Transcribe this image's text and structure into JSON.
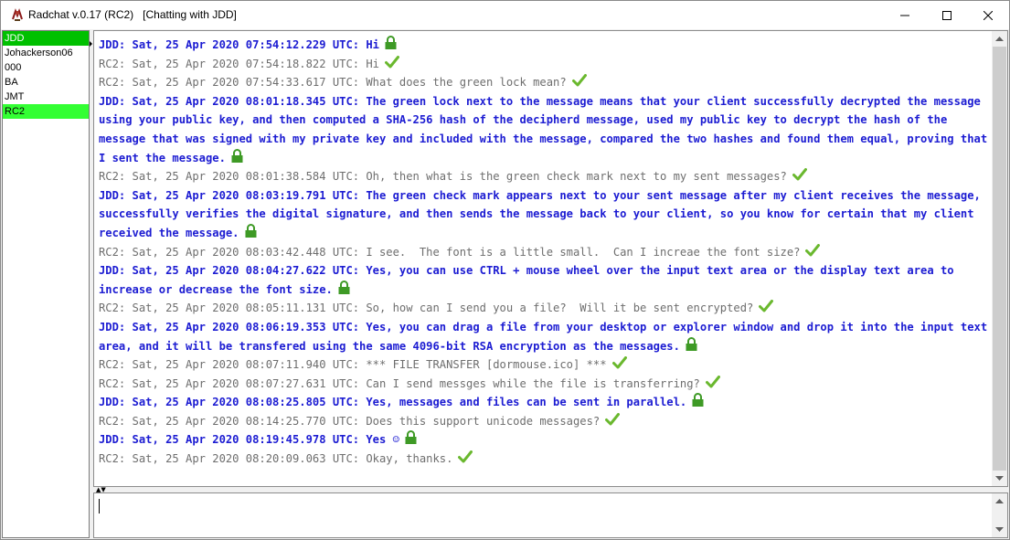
{
  "window": {
    "title": "Radchat v.0.17 (RC2)   [Chatting with JDD]",
    "minimize_glyph": "—",
    "maximize_glyph": "☐",
    "close_glyph": "✕"
  },
  "contacts": [
    {
      "name": "JDD",
      "state": "selected"
    },
    {
      "name": "Johackerson06",
      "state": "normal"
    },
    {
      "name": "000",
      "state": "normal"
    },
    {
      "name": "BA",
      "state": "normal"
    },
    {
      "name": "JMT",
      "state": "normal"
    },
    {
      "name": "RC2",
      "state": "self"
    }
  ],
  "messages": [
    {
      "who": "peer",
      "text": "JDD: Sat, 25 Apr 2020 07:54:12.229 UTC: Hi",
      "status": "lock"
    },
    {
      "who": "me",
      "text": "RC2: Sat, 25 Apr 2020 07:54:18.822 UTC: Hi",
      "status": "check"
    },
    {
      "who": "me",
      "text": "RC2: Sat, 25 Apr 2020 07:54:33.617 UTC: What does the green lock mean?",
      "status": "check"
    },
    {
      "who": "peer",
      "text": "JDD: Sat, 25 Apr 2020 08:01:18.345 UTC: The green lock next to the message means that your client successfully decrypted the message using your public key, and then computed a SHA-256 hash of the decipherd message, used my public key to decrypt the hash of the message that was signed with my private key and included with the message, compared the two hashes and found them equal, proving that I sent the message.",
      "status": "lock"
    },
    {
      "who": "me",
      "text": "RC2: Sat, 25 Apr 2020 08:01:38.584 UTC: Oh, then what is the green check mark next to my sent messages?",
      "status": "check"
    },
    {
      "who": "peer",
      "text": "JDD: Sat, 25 Apr 2020 08:03:19.791 UTC: The green check mark appears next to your sent message after my client receives the message, successfully verifies the digital signature, and then sends the message back to your client, so you know for certain that my client received the message.",
      "status": "lock"
    },
    {
      "who": "me",
      "text": "RC2: Sat, 25 Apr 2020 08:03:42.448 UTC: I see.  The font is a little small.  Can I increae the font size?",
      "status": "check"
    },
    {
      "who": "peer",
      "text": "JDD: Sat, 25 Apr 2020 08:04:27.622 UTC: Yes, you can use CTRL + mouse wheel over the input text area or the display text area to increase or decrease the font size.",
      "status": "lock"
    },
    {
      "who": "me",
      "text": "RC2: Sat, 25 Apr 2020 08:05:11.131 UTC: So, how can I send you a file?  Will it be sent encrypted?",
      "status": "check"
    },
    {
      "who": "peer",
      "text": "JDD: Sat, 25 Apr 2020 08:06:19.353 UTC: Yes, you can drag a file from your desktop or explorer window and drop it into the input text area, and it will be transfered using the same 4096-bit RSA encryption as the messages.",
      "status": "lock"
    },
    {
      "who": "me",
      "text": "RC2: Sat, 25 Apr 2020 08:07:11.940 UTC: *** FILE TRANSFER [dormouse.ico] ***",
      "status": "check"
    },
    {
      "who": "me",
      "text": "RC2: Sat, 25 Apr 2020 08:07:27.631 UTC: Can I send messges while the file is transferring?",
      "status": "check"
    },
    {
      "who": "peer",
      "text": "JDD: Sat, 25 Apr 2020 08:08:25.805 UTC: Yes, messages and files can be sent in parallel.",
      "status": "lock"
    },
    {
      "who": "me",
      "text": "RC2: Sat, 25 Apr 2020 08:14:25.770 UTC: Does this support unicode messages?",
      "status": "check"
    },
    {
      "who": "peer",
      "text": "JDD: Sat, 25 Apr 2020 08:19:45.978 UTC: Yes ☺",
      "status": "lock"
    },
    {
      "who": "me",
      "text": "RC2: Sat, 25 Apr 2020 08:20:09.063 UTC: Okay, thanks.",
      "status": "check"
    }
  ],
  "input": {
    "value": ""
  },
  "colors": {
    "peer_text": "#1c1cd2",
    "self_text": "#6e6e6e",
    "status_green": "#6ab82e",
    "lock_green": "#3e9a25",
    "contact_selected": "#00c000",
    "contact_self": "#33ff33"
  },
  "icons": {
    "app": "dormouse-icon",
    "verified_incoming": "green-lock-icon",
    "delivered_outgoing": "green-check-icon"
  }
}
